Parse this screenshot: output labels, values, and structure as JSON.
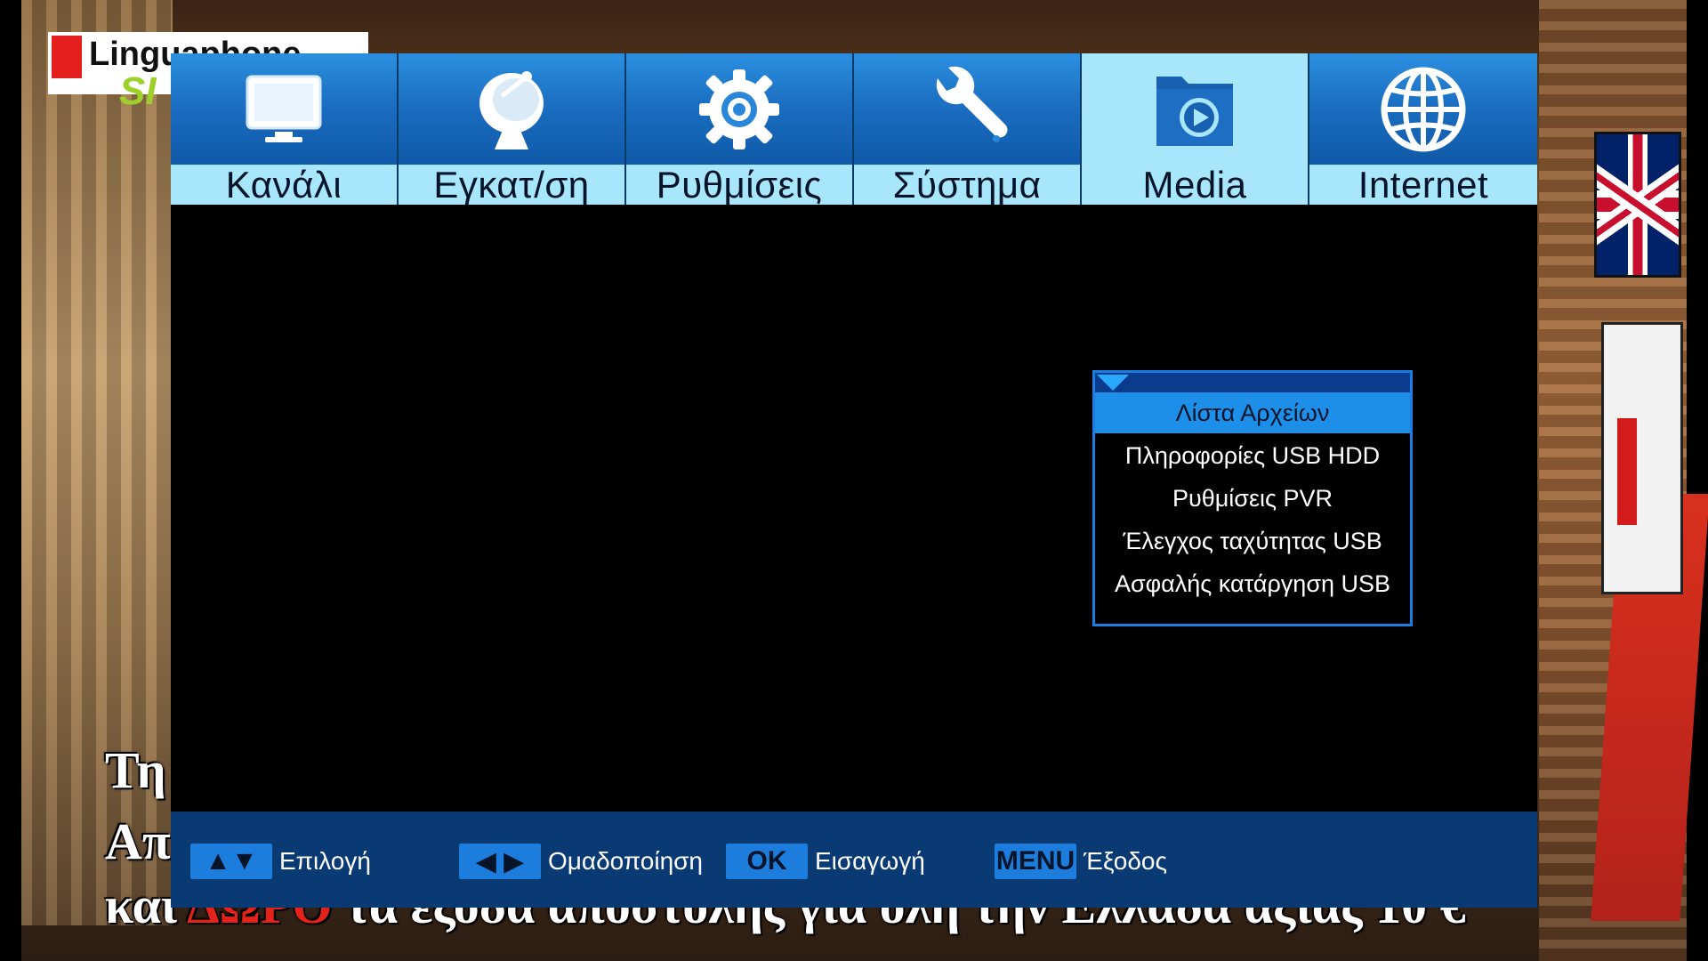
{
  "background": {
    "logo": {
      "brand_text": "Linguaphone",
      "brand_suffix": "SI"
    },
    "subtitle_lines": [
      {
        "text": "Τη"
      },
      {
        "text": "Απ"
      },
      {
        "prefix": "και ",
        "highlight": "ΔΩΡΟ",
        "rest": " τα έξοδα αποστολής για όλη την Ελλάδα αξίας 10 €"
      }
    ]
  },
  "tabs": [
    {
      "label": "Κανάλι",
      "icon": "tv-icon",
      "active": false
    },
    {
      "label": "Εγκατ/ση",
      "icon": "satellite-dish-icon",
      "active": false
    },
    {
      "label": "Ρυθμίσεις",
      "icon": "gear-icon",
      "active": false
    },
    {
      "label": "Σύστημα",
      "icon": "wrench-icon",
      "active": false
    },
    {
      "label": "Media",
      "icon": "media-folder-icon",
      "active": true
    },
    {
      "label": "Internet",
      "icon": "globe-icon",
      "active": false
    }
  ],
  "submenu": {
    "items": [
      {
        "label": "Λίστα Αρχείων",
        "selected": true
      },
      {
        "label": "Πληροφορίες USB HDD",
        "selected": false
      },
      {
        "label": "Ρυθμίσεις PVR",
        "selected": false
      },
      {
        "label": "Έλεγχος ταχύτητας USB",
        "selected": false
      },
      {
        "label": "Ασφαλής κατάργηση USB",
        "selected": false
      }
    ]
  },
  "hints": [
    {
      "key": "▲▼",
      "label": "Επιλογή"
    },
    {
      "key": "◀ ▶",
      "label": "Ομαδοποίηση"
    },
    {
      "key": "OK",
      "label": "Εισαγωγή"
    },
    {
      "key": "MENU",
      "label": "Έξοδος"
    }
  ],
  "colors": {
    "tab_gradient_top": "#2b8fdf",
    "tab_label_bg": "#a8e6fb",
    "selected_item": "#1e8fe8",
    "bottom_bar": "#0a3a74",
    "key_bg": "#1c7ddc"
  }
}
